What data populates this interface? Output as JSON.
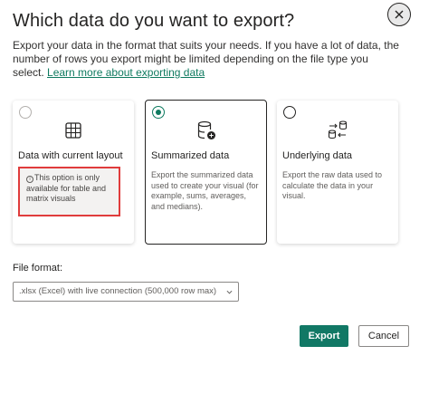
{
  "dialog": {
    "title": "Which data do you want to export?",
    "description": "Export your data in the format that suits your needs. If you have a lot of data, the number of rows you export might be limited depending on the file type you select.",
    "learn_more": "Learn more about exporting data"
  },
  "options": [
    {
      "title": "Data with current layout",
      "note": "This option is only available for table and matrix visuals",
      "selected": false,
      "disabled": true,
      "icon": "table-icon"
    },
    {
      "title": "Summarized data",
      "text": "Export the summarized data used to create your visual (for example, sums, averages, and medians).",
      "selected": true,
      "icon": "database-summary-icon"
    },
    {
      "title": "Underlying data",
      "text": "Export the raw data used to calculate the data in your visual.",
      "selected": false,
      "icon": "data-transfer-icon"
    }
  ],
  "file_format": {
    "label": "File format:",
    "value": ".xlsx (Excel) with live connection (500,000 row max)"
  },
  "buttons": {
    "export": "Export",
    "cancel": "Cancel"
  },
  "colors": {
    "accent": "#117865",
    "highlight_border": "#e03c3c"
  }
}
